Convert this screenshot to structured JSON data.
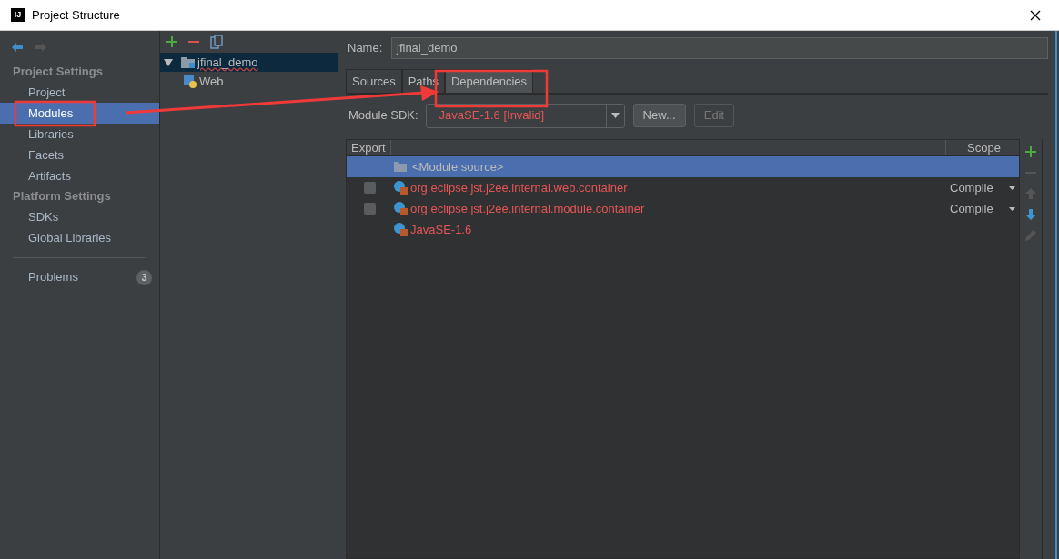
{
  "window": {
    "title": "Project Structure",
    "logo": "IJ"
  },
  "sidebar": {
    "sections": [
      {
        "title": "Project Settings",
        "items": [
          {
            "label": "Project",
            "selected": false
          },
          {
            "label": "Modules",
            "selected": true
          },
          {
            "label": "Libraries",
            "selected": false
          },
          {
            "label": "Facets",
            "selected": false
          },
          {
            "label": "Artifacts",
            "selected": false
          }
        ]
      },
      {
        "title": "Platform Settings",
        "items": [
          {
            "label": "SDKs",
            "selected": false
          },
          {
            "label": "Global Libraries",
            "selected": false
          }
        ]
      }
    ],
    "problems": {
      "label": "Problems",
      "count": "3"
    }
  },
  "tree": [
    {
      "label": "jfinal_demo",
      "kind": "module",
      "selected": true,
      "expanded": true,
      "children": [
        {
          "label": "Web",
          "kind": "web",
          "selected": false
        }
      ]
    }
  ],
  "name_field": {
    "label": "Name:",
    "value": "jfinal_demo"
  },
  "tabs": [
    {
      "label": "Sources",
      "selected": false
    },
    {
      "label": "Paths",
      "selected": false
    },
    {
      "label": "Dependencies",
      "selected": true
    }
  ],
  "module_sdk": {
    "label": "Module SDK:",
    "value": "JavaSE-1.6 [Invalid]",
    "buttons": [
      {
        "label": "New...",
        "disabled": false
      },
      {
        "label": "Edit",
        "disabled": true
      }
    ]
  },
  "table": {
    "columns": [
      "Export",
      "Scope"
    ],
    "rows": [
      {
        "kind": "source",
        "label": "<Module source>",
        "selected": true
      },
      {
        "kind": "library",
        "label": "org.eclipse.jst.j2ee.internal.web.container",
        "checked": false,
        "scope": "Compile",
        "selected": false
      },
      {
        "kind": "library",
        "label": "org.eclipse.jst.j2ee.internal.module.container",
        "checked": false,
        "scope": "Compile",
        "selected": false
      },
      {
        "kind": "sdk",
        "label": "JavaSE-1.6",
        "selected": false
      }
    ]
  },
  "table_toolbar": [
    {
      "kind": "add",
      "disabled": false
    },
    {
      "kind": "remove",
      "disabled": true
    },
    {
      "kind": "up",
      "disabled": true
    },
    {
      "kind": "down",
      "disabled": false
    },
    {
      "kind": "edit",
      "disabled": true
    }
  ]
}
